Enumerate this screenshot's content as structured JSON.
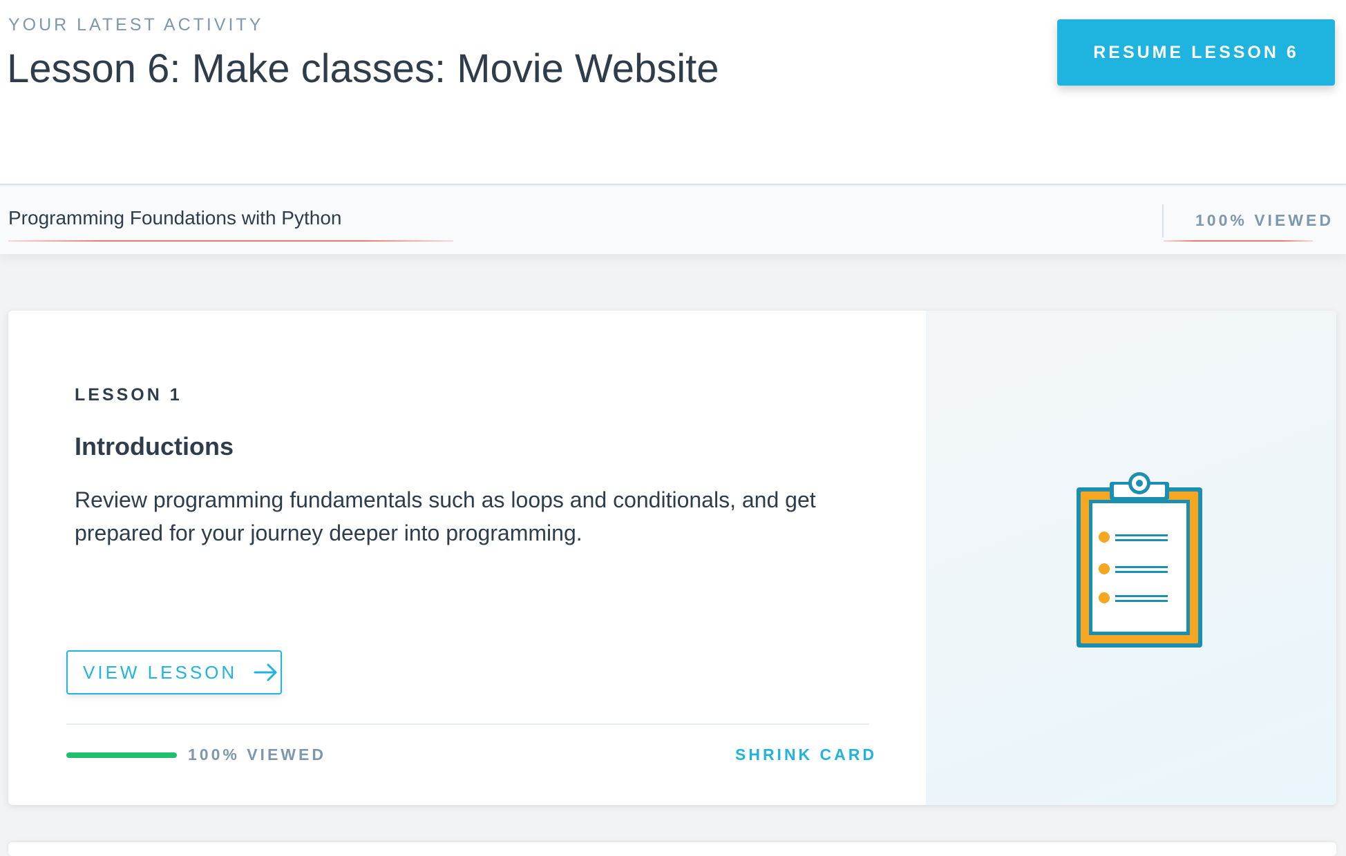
{
  "header": {
    "eyebrow": "YOUR LATEST ACTIVITY",
    "title": "Lesson 6: Make classes: Movie Website",
    "resume_button": "RESUME LESSON 6"
  },
  "course_bar": {
    "course_name": "Programming Foundations with Python",
    "progress_label": "100% VIEWED"
  },
  "lesson_card": {
    "label": "LESSON 1",
    "name": "Introductions",
    "description": "Review programming fundamentals such as loops and conditionals, and get prepared for your journey deeper into programming.",
    "view_button": "VIEW LESSON",
    "progress_fraction": 1.0,
    "progress_label": "100% VIEWED",
    "shrink_link": "SHRINK CARD",
    "illustration_icon": "clipboard-checklist-icon"
  },
  "colors": {
    "accent": "#1fb4e0",
    "progress": "#1fbf6e",
    "clipboard_frame": "#1c8fb0",
    "clipboard_board": "#f5a623",
    "underline": "#f07b6a"
  }
}
